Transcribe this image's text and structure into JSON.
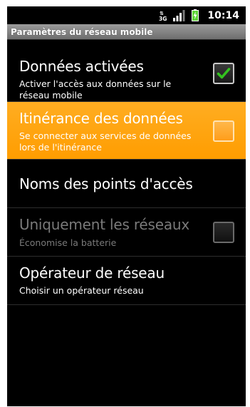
{
  "status_bar": {
    "network_type": "3G",
    "time": "10:14"
  },
  "title_bar": {
    "title": "Paramètres du réseau mobile"
  },
  "settings": [
    {
      "title": "Données activées",
      "summary": "Activer l'accès aux données sur le réseau mobile",
      "checkbox": "checked",
      "state": "normal"
    },
    {
      "title": "Itinérance des données",
      "summary": "Se connecter aux services de données lors de l'itinérance",
      "checkbox": "unchecked",
      "state": "selected"
    },
    {
      "title": "Noms des points d'accès",
      "summary": "",
      "checkbox": "none",
      "state": "normal"
    },
    {
      "title": "Uniquement les réseaux",
      "summary": "Économise la batterie",
      "checkbox": "unchecked",
      "state": "disabled"
    },
    {
      "title": "Opérateur de réseau",
      "summary": "Choisir un opérateur réseau",
      "checkbox": "none",
      "state": "normal"
    }
  ],
  "colors": {
    "selection": "#ff9d00",
    "check": "#34c31f",
    "battery": "#5ed437"
  },
  "icons": {
    "network": "3g-icon",
    "signal": "signal-strength-icon",
    "battery": "battery-charging-icon",
    "check": "checkmark-icon"
  }
}
